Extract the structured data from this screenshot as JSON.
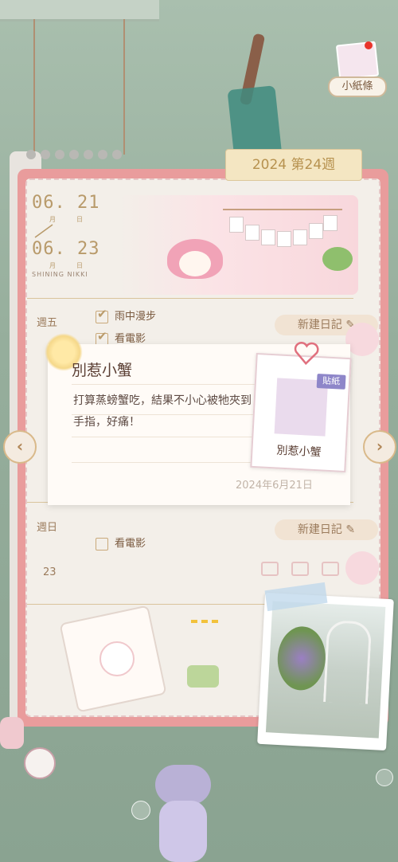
{
  "note_button": {
    "label": "小紙條",
    "icon": "note-photo-icon"
  },
  "journal": {
    "week_tab": "2024 第24週",
    "date_start": {
      "month": "06.",
      "day": "21",
      "month_label": "月",
      "day_label": "日"
    },
    "date_end": {
      "month": "06.",
      "day": "23",
      "month_label": "月",
      "day_label": "日"
    },
    "brand": "SHINING NIKKI",
    "new_entry_label": "新建日記",
    "days": [
      {
        "weekday": "週五",
        "todos": [
          {
            "text": "雨中漫步",
            "checked": true
          },
          {
            "text": "看電影",
            "checked": true
          }
        ]
      },
      {
        "weekday": "週日",
        "date": "23",
        "todos": [
          {
            "text": "看電影",
            "checked": false
          }
        ]
      }
    ]
  },
  "popup": {
    "title": "別惹小蟹",
    "text": "打算蒸螃蟹吃，結果不小心被牠夾到手指，好痛！",
    "date": "2024年6月21日",
    "sticker": {
      "tag": "貼紙",
      "label": "別惹小蟹"
    }
  },
  "nav": {
    "prev": "‹",
    "next": "›"
  },
  "colors": {
    "accent_pink": "#e99c9c",
    "paper": "#f3efe9",
    "gold": "#b89a6a"
  }
}
